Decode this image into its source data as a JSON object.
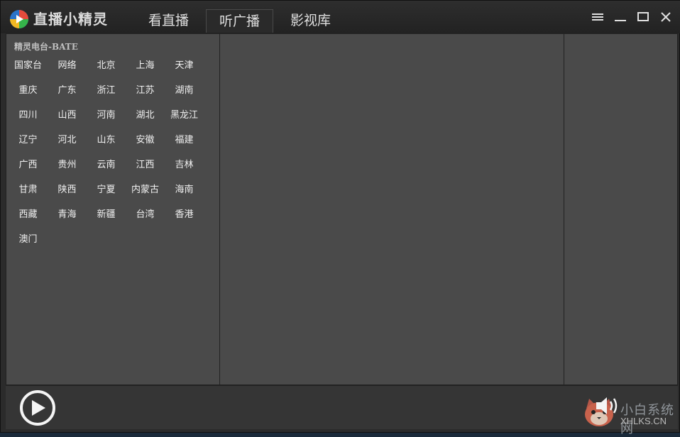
{
  "app": {
    "title": "直播小精灵"
  },
  "tabs": [
    {
      "label": "看直播",
      "active": false
    },
    {
      "label": "听广播",
      "active": true
    },
    {
      "label": "影视库",
      "active": false
    }
  ],
  "window_controls": [
    "menu-icon",
    "minimize-icon",
    "maximize-icon",
    "close-icon"
  ],
  "radio": {
    "section_title": "精灵电台-BATE",
    "regions": [
      "国家台",
      "网络",
      "北京",
      "上海",
      "天津",
      "重庆",
      "广东",
      "浙江",
      "江苏",
      "湖南",
      "四川",
      "山西",
      "河南",
      "湖北",
      "黑龙江",
      "辽宁",
      "河北",
      "山东",
      "安徽",
      "福建",
      "广西",
      "贵州",
      "云南",
      "江西",
      "吉林",
      "甘肃",
      "陕西",
      "宁夏",
      "内蒙古",
      "海南",
      "西藏",
      "青海",
      "新疆",
      "台湾",
      "香港",
      "澳门"
    ]
  },
  "player": {
    "play_icon": "play-icon",
    "volume_icon": "volume-icon"
  },
  "watermark": {
    "line1": "小白系统网",
    "line2": "XHLKS.CN"
  },
  "colors": {
    "background": "#2b2b2b",
    "pane": "#4a4a4a",
    "text": "#f0f0f0"
  }
}
